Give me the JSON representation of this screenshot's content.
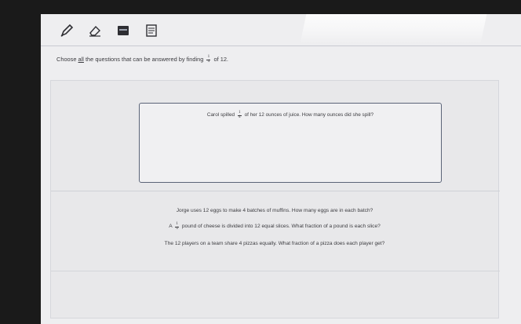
{
  "toolbar": {
    "tools": [
      {
        "icon": "pencil-icon"
      },
      {
        "icon": "eraser-icon"
      },
      {
        "icon": "keyboard-icon"
      },
      {
        "icon": "notepad-icon"
      }
    ]
  },
  "prompt": {
    "before": "Choose ",
    "emphasis": "all",
    "middle": " the questions that can be answered by finding ",
    "frac_num": "1",
    "frac_den": "4",
    "after": " of 12."
  },
  "selected_answer": {
    "before": "Carol spilled ",
    "frac_num": "1",
    "frac_den": "4",
    "after": " of her 12 ounces of juice. How many ounces did she spill?"
  },
  "choices": [
    {
      "text": "Jorge uses 12 eggs to make 4 batches of muffins. How many eggs are in each batch?"
    },
    {
      "before": "A ",
      "frac_num": "1",
      "frac_den": "4",
      "after": " pound of cheese is divided into 12 equal slices. What fraction of a pound is each slice?"
    },
    {
      "text": "The 12 players on a team share 4 pizzas equally. What fraction of a pizza does each player get?"
    }
  ]
}
